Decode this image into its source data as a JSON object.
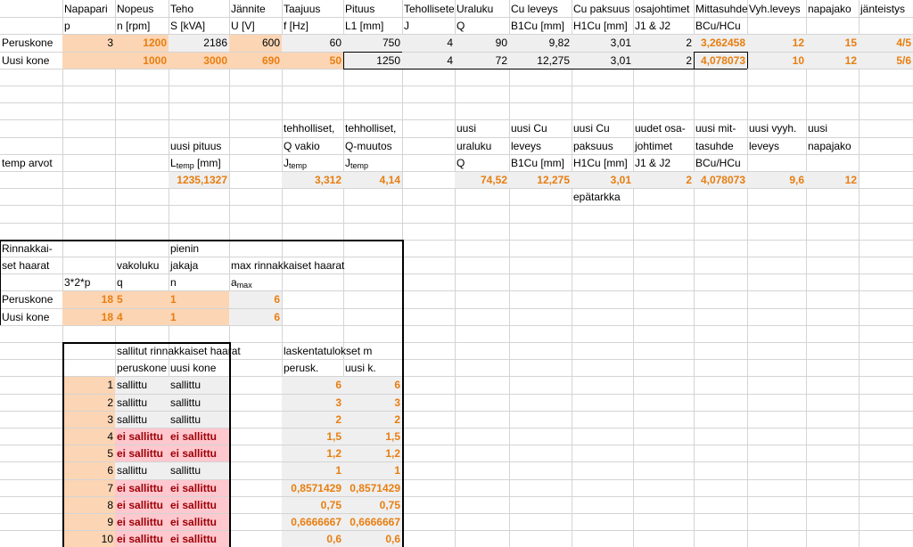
{
  "header": {
    "row1": [
      "Napapari",
      "Nopeus",
      "Teho",
      "Jännite",
      "Taajuus",
      "Pituus",
      "Tehollisete",
      "Uraluku",
      "Cu leveys",
      "Cu paksuus",
      "osajohtimet",
      "Mittasuhde",
      "Vyh.leveys",
      "napajako",
      "jänteistys"
    ],
    "row2": [
      "p",
      "n [rpm]",
      "S [kVA]",
      "U [V]",
      "f [Hz]",
      "L1 [mm]",
      "J",
      "Q",
      "B1Cu [mm]",
      "H1Cu [mm]",
      "J1 & J2",
      "BCu/HCu",
      "",
      "",
      ""
    ]
  },
  "machines": [
    {
      "label": "Peruskone",
      "values": [
        "3",
        "1200",
        "2186",
        "600",
        "60",
        "750",
        "4",
        "90",
        "9,82",
        "3,01",
        "2",
        "3,262458",
        "12",
        "15",
        "4/5"
      ]
    },
    {
      "label": "Uusi kone",
      "values": [
        "",
        "1000",
        "3000",
        "690",
        "50",
        "1250",
        "4",
        "72",
        "12,275",
        "3,01",
        "2",
        "4,078073",
        "10",
        "12",
        "5/6"
      ]
    }
  ],
  "temp": {
    "row_label": "temp arvot",
    "h_pituus": [
      "uusi pituus",
      "L",
      "temp",
      " [mm]"
    ],
    "h_teh1": [
      "tehholliset,",
      "Q vakio",
      "J",
      "temp"
    ],
    "h_teh2": [
      "tehholliset,",
      "Q-muutos",
      "J",
      "temp"
    ],
    "h_ura": [
      "uusi",
      "uraluku",
      "Q"
    ],
    "h_cul": [
      "uusi Cu",
      "leveys",
      "B1Cu [mm]"
    ],
    "h_cup": [
      "uusi Cu",
      "paksuus",
      "H1Cu [mm]"
    ],
    "h_osa": [
      "uudet osa-",
      "johtimet",
      "J1 & J2"
    ],
    "h_mitta": [
      "uusi mit-",
      "tasuhde",
      "BCu/HCu"
    ],
    "h_vyh": [
      "uusi vyyh.",
      "leveys"
    ],
    "h_napa": [
      "uusi",
      "napajako"
    ],
    "values": {
      "pituus": "1235,1327",
      "teh1": "3,312",
      "teh2": "4,14",
      "ura": "74,52",
      "cul": "12,275",
      "cup": "3,01",
      "osa": "2",
      "mitta": "4,078073",
      "vyh": "9,6",
      "napa": "12"
    },
    "note": "epätarkka"
  },
  "parallel": {
    "title1": "Rinnakkai-",
    "title2": "set haarat",
    "col_a": "3*2*p",
    "col_b": "vakoluku",
    "col_b2": "q",
    "col_c1": "pienin",
    "col_c2": "jakaja",
    "col_c3": "n",
    "col_d": "max rinnakkaiset haarat",
    "col_d2_base": "a",
    "col_d2_sub": "max",
    "rows": [
      {
        "label": "Peruskone",
        "a": "18",
        "q": "5",
        "n": "1",
        "amax": "6"
      },
      {
        "label": "Uusi kone",
        "a": "18",
        "q": "4",
        "n": "1",
        "amax": "6"
      }
    ]
  },
  "allowed": {
    "header": "sallitut rinnakkaiset haarat",
    "col1": "peruskone",
    "col2": "uusi kone",
    "calc_header": "laskentatulokset m",
    "calc_col1": "perusk.",
    "calc_col2": "uusi k.",
    "rows": [
      {
        "n": "1",
        "p": "sallittu",
        "u": "sallittu",
        "m1": "6",
        "m2": "6"
      },
      {
        "n": "2",
        "p": "sallittu",
        "u": "sallittu",
        "m1": "3",
        "m2": "3"
      },
      {
        "n": "3",
        "p": "sallittu",
        "u": "sallittu",
        "m1": "2",
        "m2": "2"
      },
      {
        "n": "4",
        "p": "ei sallittu",
        "u": "ei sallittu",
        "m1": "1,5",
        "m2": "1,5"
      },
      {
        "n": "5",
        "p": "ei sallittu",
        "u": "ei sallittu",
        "m1": "1,2",
        "m2": "1,2"
      },
      {
        "n": "6",
        "p": "sallittu",
        "u": "sallittu",
        "m1": "1",
        "m2": "1"
      },
      {
        "n": "7",
        "p": "ei sallittu",
        "u": "ei sallittu",
        "m1": "0,8571429",
        "m2": "0,8571429"
      },
      {
        "n": "8",
        "p": "ei sallittu",
        "u": "ei sallittu",
        "m1": "0,75",
        "m2": "0,75"
      },
      {
        "n": "9",
        "p": "ei sallittu",
        "u": "ei sallittu",
        "m1": "0,6666667",
        "m2": "0,6666667"
      },
      {
        "n": "10",
        "p": "ei sallittu",
        "u": "ei sallittu",
        "m1": "0,6",
        "m2": "0,6"
      }
    ]
  }
}
